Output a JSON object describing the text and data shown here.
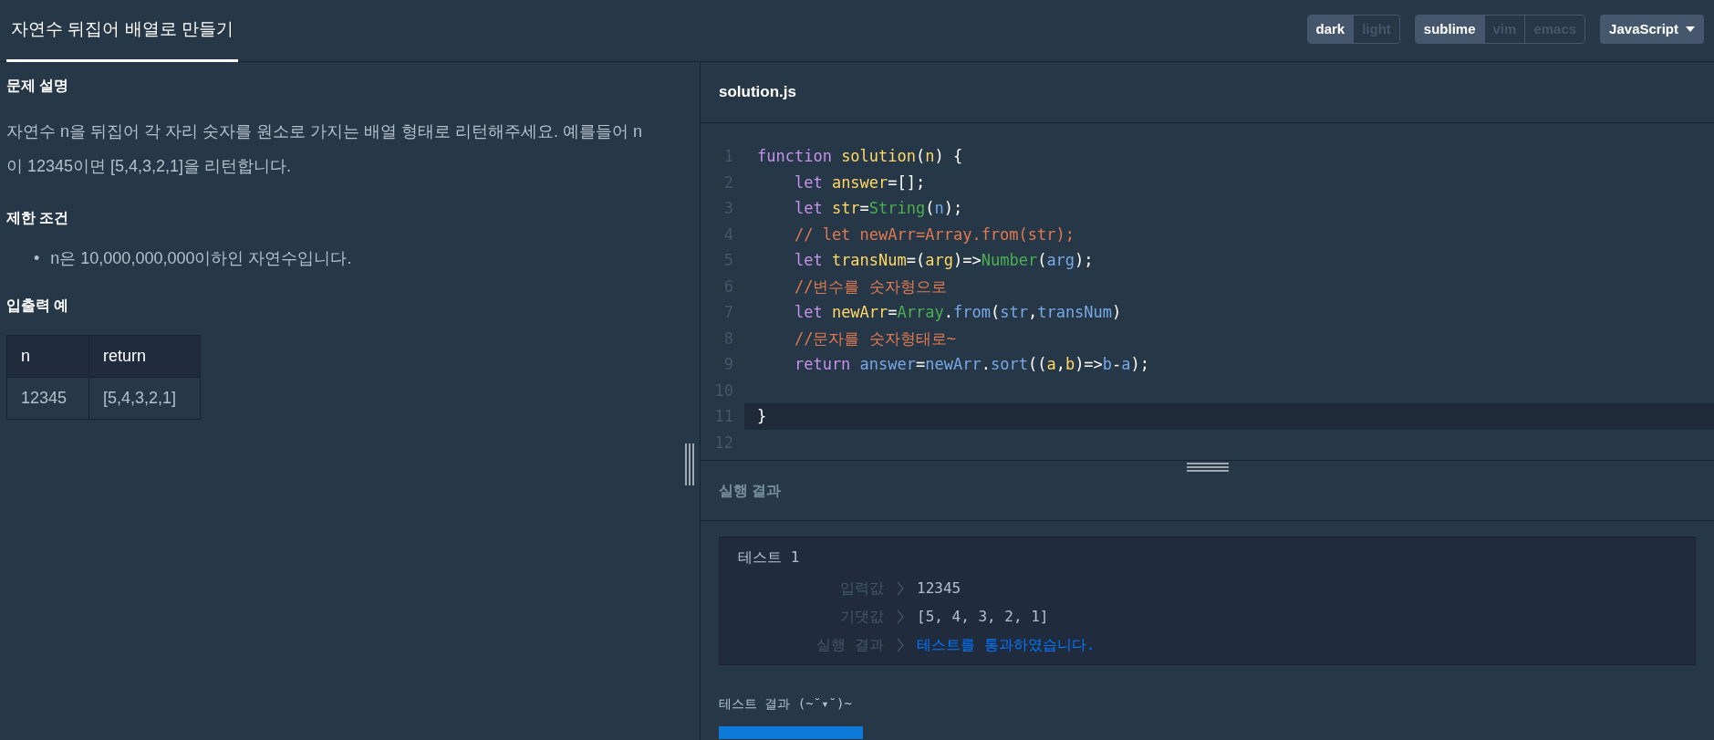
{
  "header": {
    "tab": {
      "label": "자연수 뒤집어 배열로 만들기",
      "selected": true
    },
    "theme": [
      {
        "label": "dark",
        "selected": true
      },
      {
        "label": "light",
        "selected": false
      }
    ],
    "keymap": [
      {
        "label": "sublime",
        "selected": true
      },
      {
        "label": "vim",
        "selected": false
      },
      {
        "label": "emacs",
        "selected": false
      }
    ],
    "language": "JavaScript"
  },
  "problem": {
    "sections": [
      {
        "kind": "paragraph",
        "heading": "문제 설명",
        "text": "자연수 n을 뒤집어 각 자리 숫자를 원소로 가지는 배열 형태로 리턴해주세요. 예를들어 n이 12345이면 [5,4,3,2,1]을 리턴합니다."
      },
      {
        "kind": "list",
        "heading": "제한 조건",
        "bullet": "•",
        "items": [
          "n은 10,000,000,000이하인 자연수입니다."
        ]
      },
      {
        "kind": "table",
        "heading": "입출력 예",
        "columns": [
          "n",
          "return"
        ],
        "rows": [
          [
            "12345",
            "[5,4,3,2,1]"
          ]
        ]
      }
    ]
  },
  "editor": {
    "filename": "solution.js",
    "lines": [
      {
        "number": "1",
        "current": false,
        "indented": false,
        "tokens": [
          {
            "kind": "keyword",
            "text": "function "
          },
          {
            "kind": "name",
            "text": "solution"
          },
          {
            "kind": "plain",
            "text": "("
          },
          {
            "kind": "name",
            "text": "n"
          },
          {
            "kind": "plain",
            "text": ") {"
          }
        ]
      },
      {
        "number": "2",
        "current": false,
        "indented": true,
        "tokens": [
          {
            "kind": "keyword",
            "text": "let "
          },
          {
            "kind": "name",
            "text": "answer"
          },
          {
            "kind": "plain",
            "text": "=[];"
          }
        ]
      },
      {
        "number": "3",
        "current": false,
        "indented": true,
        "tokens": [
          {
            "kind": "keyword",
            "text": "let "
          },
          {
            "kind": "name",
            "text": "str"
          },
          {
            "kind": "plain",
            "text": "="
          },
          {
            "kind": "builtin",
            "text": "String"
          },
          {
            "kind": "plain",
            "text": "("
          },
          {
            "kind": "variable",
            "text": "n"
          },
          {
            "kind": "plain",
            "text": ");"
          }
        ]
      },
      {
        "number": "4",
        "current": false,
        "indented": true,
        "tokens": [
          {
            "kind": "comment",
            "text": "// let newArr=Array.from(str);"
          }
        ]
      },
      {
        "number": "5",
        "current": false,
        "indented": true,
        "tokens": [
          {
            "kind": "keyword",
            "text": "let "
          },
          {
            "kind": "name",
            "text": "transNum"
          },
          {
            "kind": "plain",
            "text": "=("
          },
          {
            "kind": "name",
            "text": "arg"
          },
          {
            "kind": "plain",
            "text": ")=>"
          },
          {
            "kind": "builtin",
            "text": "Number"
          },
          {
            "kind": "plain",
            "text": "("
          },
          {
            "kind": "variable",
            "text": "arg"
          },
          {
            "kind": "plain",
            "text": ");"
          }
        ]
      },
      {
        "number": "6",
        "current": false,
        "indented": true,
        "tokens": [
          {
            "kind": "comment",
            "text": "//변수를 숫자형으로"
          }
        ]
      },
      {
        "number": "7",
        "current": false,
        "indented": true,
        "tokens": [
          {
            "kind": "keyword",
            "text": "let "
          },
          {
            "kind": "name",
            "text": "newArr"
          },
          {
            "kind": "plain",
            "text": "="
          },
          {
            "kind": "builtin",
            "text": "Array"
          },
          {
            "kind": "plain",
            "text": "."
          },
          {
            "kind": "variable",
            "text": "from"
          },
          {
            "kind": "plain",
            "text": "("
          },
          {
            "kind": "variable",
            "text": "str"
          },
          {
            "kind": "plain",
            "text": ","
          },
          {
            "kind": "variable",
            "text": "transNum"
          },
          {
            "kind": "plain",
            "text": ")"
          }
        ]
      },
      {
        "number": "8",
        "current": false,
        "indented": true,
        "tokens": [
          {
            "kind": "comment",
            "text": "//문자를 숫자형태로~"
          }
        ]
      },
      {
        "number": "9",
        "current": false,
        "indented": true,
        "tokens": [
          {
            "kind": "keyword",
            "text": "return "
          },
          {
            "kind": "variable",
            "text": "answer"
          },
          {
            "kind": "plain",
            "text": "="
          },
          {
            "kind": "variable",
            "text": "newArr"
          },
          {
            "kind": "plain",
            "text": "."
          },
          {
            "kind": "variable",
            "text": "sort"
          },
          {
            "kind": "plain",
            "text": "(("
          },
          {
            "kind": "name",
            "text": "a"
          },
          {
            "kind": "plain",
            "text": ","
          },
          {
            "kind": "name",
            "text": "b"
          },
          {
            "kind": "plain",
            "text": ")=>"
          },
          {
            "kind": "variable",
            "text": "b"
          },
          {
            "kind": "plain",
            "text": "-"
          },
          {
            "kind": "variable",
            "text": "a"
          },
          {
            "kind": "plain",
            "text": ");"
          }
        ]
      },
      {
        "number": "10",
        "current": false
      },
      {
        "number": "11",
        "current": true,
        "indented": false,
        "tokens": [
          {
            "kind": "plain",
            "text": "}"
          }
        ]
      },
      {
        "number": "12",
        "current": false
      }
    ]
  },
  "results": {
    "title": "실행 결과",
    "tests": [
      {
        "title": "테스트 1",
        "rows": [
          {
            "kind": "value",
            "label": "입력값",
            "value": "12345"
          },
          {
            "kind": "value",
            "label": "기댓값",
            "value": "[5, 4, 3, 2, 1]"
          },
          {
            "kind": "pass",
            "label": "실행 결과",
            "value": "테스트를 통과하였습니다."
          }
        ]
      }
    ],
    "summary": "테스트 결과 (~˘▾˘)~"
  }
}
